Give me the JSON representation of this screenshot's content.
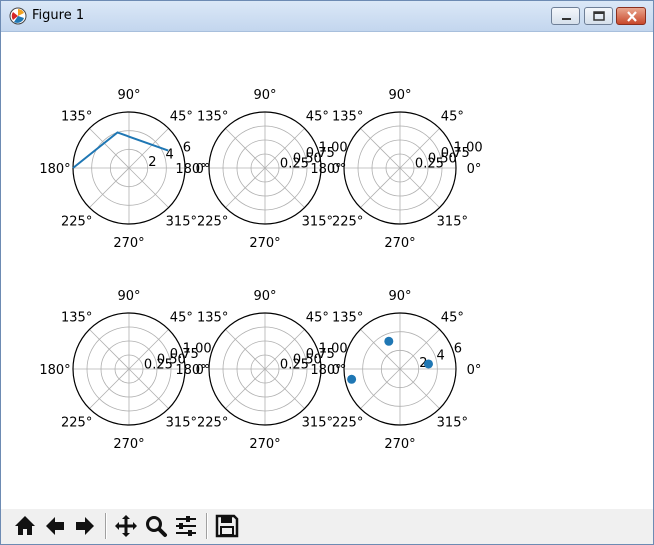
{
  "window": {
    "title": "Figure 1",
    "controls": {
      "minimize": "minimize-button",
      "maximize": "maximize-button",
      "close": "close-button"
    }
  },
  "toolbar": {
    "buttons": [
      {
        "name": "home-button",
        "icon": "home-icon"
      },
      {
        "name": "back-button",
        "icon": "arrow-left-icon"
      },
      {
        "name": "forward-button",
        "icon": "arrow-right-icon"
      },
      {
        "name": "pan-button",
        "icon": "move-icon"
      },
      {
        "name": "zoom-button",
        "icon": "magnifier-icon"
      },
      {
        "name": "configure-subplots-button",
        "icon": "sliders-icon"
      },
      {
        "name": "save-button",
        "icon": "floppy-icon"
      }
    ]
  },
  "figure": {
    "angle_labels": [
      "0°",
      "45°",
      "90°",
      "135°",
      "180°",
      "225°",
      "270°",
      "315°"
    ],
    "line_color": "#1f77b4",
    "grid_color": "#b0b0b0"
  },
  "chart_data": [
    {
      "type": "line",
      "projection": "polar",
      "r_ticks": [
        "2",
        "4",
        "6"
      ],
      "rlim": [
        0,
        6
      ],
      "series": [
        {
          "theta_deg": [
            24,
            108,
            180
          ],
          "r": [
            4.6,
            4.0,
            6.0
          ]
        }
      ]
    },
    {
      "type": "line",
      "projection": "polar",
      "r_ticks": [
        "0.25",
        "0.50",
        "0.75",
        "1.00"
      ],
      "rlim": [
        0,
        1
      ],
      "series": []
    },
    {
      "type": "line",
      "projection": "polar",
      "r_ticks": [
        "0.25",
        "0.50",
        "0.75",
        "1.00"
      ],
      "rlim": [
        0,
        1
      ],
      "series": []
    },
    {
      "type": "line",
      "projection": "polar",
      "r_ticks": [
        "0.25",
        "0.50",
        "0.75",
        "1.00"
      ],
      "rlim": [
        0,
        1
      ],
      "series": []
    },
    {
      "type": "line",
      "projection": "polar",
      "r_ticks": [
        "0.25",
        "0.50",
        "0.75",
        "1.00"
      ],
      "rlim": [
        0,
        1
      ],
      "series": []
    },
    {
      "type": "scatter",
      "projection": "polar",
      "r_ticks": [
        "2",
        "4",
        "6"
      ],
      "rlim": [
        0,
        6
      ],
      "series": [
        {
          "theta_deg": [
            10,
            112,
            192
          ],
          "r": [
            3.1,
            3.2,
            5.3
          ]
        }
      ]
    }
  ]
}
